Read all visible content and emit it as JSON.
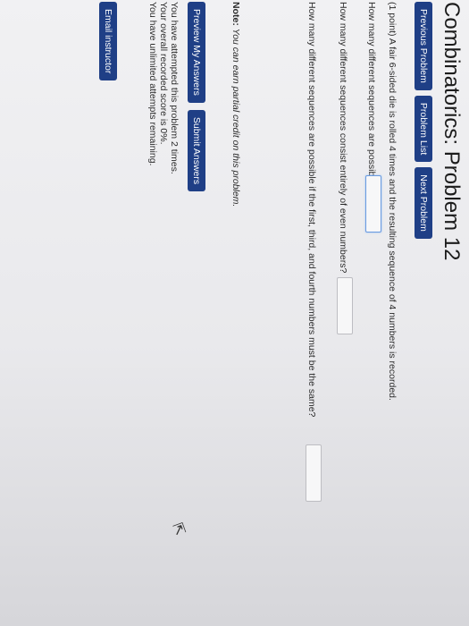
{
  "page": {
    "title": "Combinatorics: Problem 12"
  },
  "nav": {
    "previous": "Previous Problem",
    "list": "Problem List",
    "next": "Next Problem"
  },
  "problem": {
    "statement": "(1 point) A fair 6-sided die is rolled 4 times and the resulting sequence of 4 numbers is recorded.",
    "q1": "How many different sequences are possible?",
    "q2": "How many different sequences consist entirely of even numbers?",
    "q3": "How many different sequences are possible if the first, third, and fourth numbers must be the same?",
    "answers": [
      "",
      "",
      ""
    ]
  },
  "note": {
    "label": "Note:",
    "text": "You can earn partial credit on this problem."
  },
  "actions": {
    "preview": "Preview My Answers",
    "submit": "Submit Answers"
  },
  "status": {
    "attempts": "You have attempted this problem 2 times.",
    "score": "Your overall recorded score is 0%.",
    "remaining": "You have unlimited attempts remaining."
  },
  "footer": {
    "email": "Email instructor"
  },
  "colors": {
    "button": "#1f3f86",
    "focus_border": "#6a9be0"
  }
}
